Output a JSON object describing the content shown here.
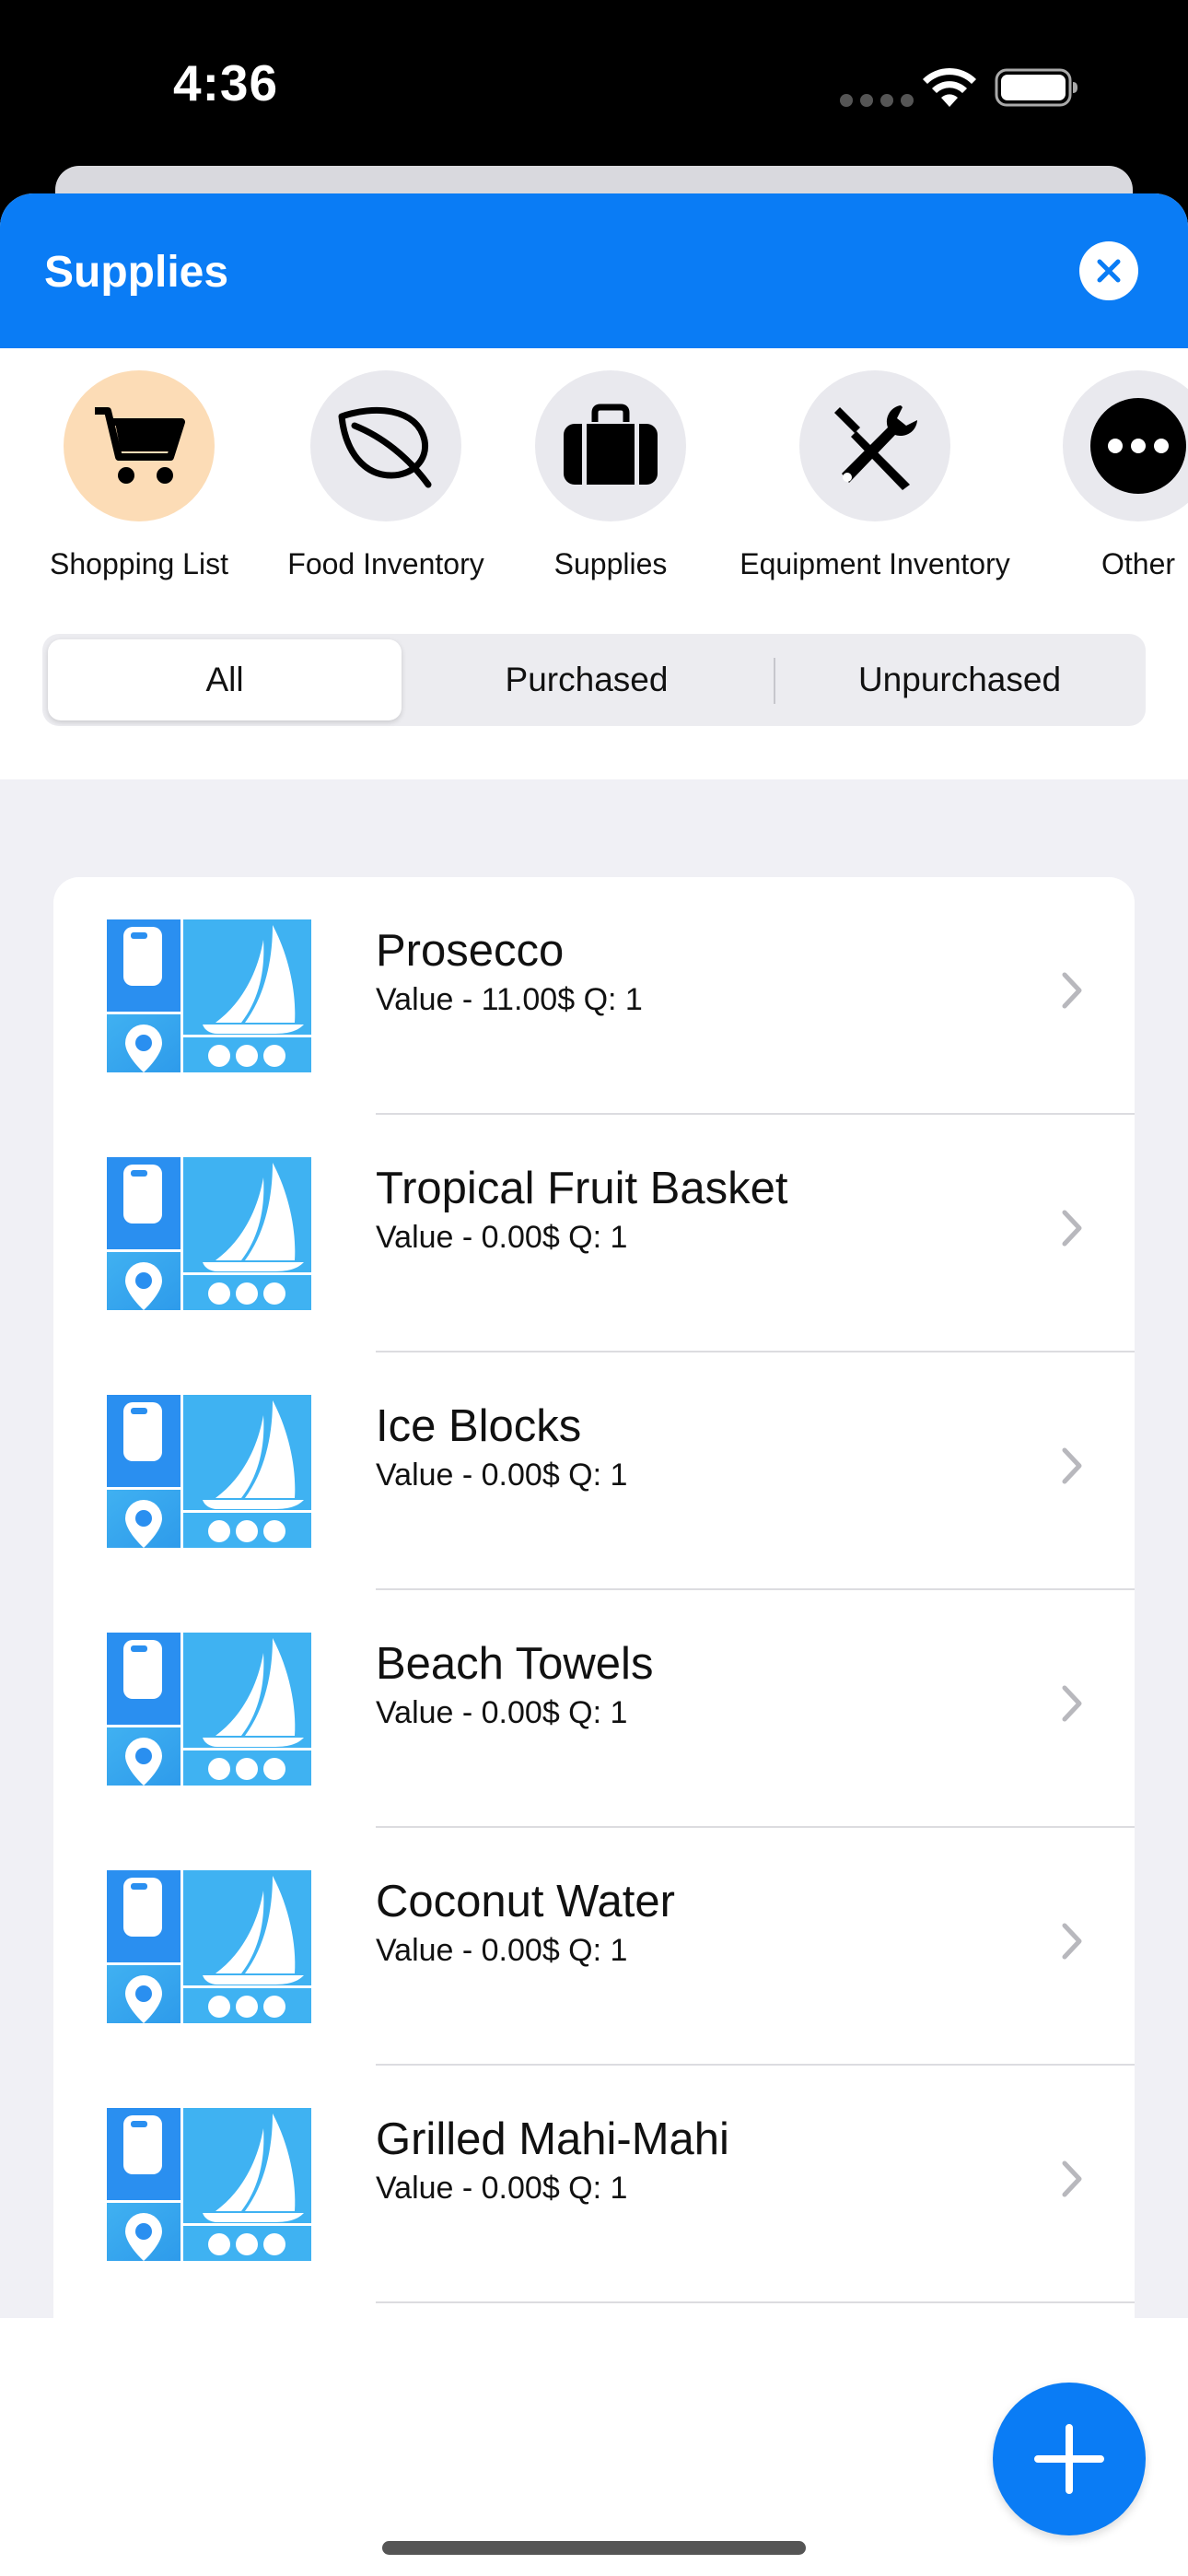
{
  "status_bar": {
    "time": "4:36"
  },
  "header": {
    "title": "Supplies"
  },
  "categories": [
    {
      "label": "Shopping List",
      "icon": "cart-icon",
      "active": true
    },
    {
      "label": "Food Inventory",
      "icon": "leaf-icon",
      "active": false
    },
    {
      "label": "Supplies",
      "icon": "briefcase-icon",
      "active": false
    },
    {
      "label": "Equipment Inventory",
      "icon": "tools-icon",
      "active": false
    },
    {
      "label": "Other",
      "icon": "more-icon",
      "active": false
    }
  ],
  "filter": {
    "options": [
      "All",
      "Purchased",
      "Unpurchased"
    ],
    "selected": "All"
  },
  "items": [
    {
      "name": "Prosecco",
      "detail": "Value - 11.00$ Q: 1"
    },
    {
      "name": "Tropical Fruit Basket",
      "detail": "Value - 0.00$ Q: 1"
    },
    {
      "name": "Ice Blocks",
      "detail": "Value - 0.00$ Q: 1"
    },
    {
      "name": "Beach Towels",
      "detail": "Value - 0.00$ Q: 1"
    },
    {
      "name": "Coconut Water",
      "detail": "Value - 0.00$ Q: 1"
    },
    {
      "name": "Grilled Mahi-Mahi",
      "detail": "Value - 0.00$ Q: 1"
    }
  ],
  "colors": {
    "accent": "#0a7cf5",
    "active_category": "#fcdcb6"
  }
}
